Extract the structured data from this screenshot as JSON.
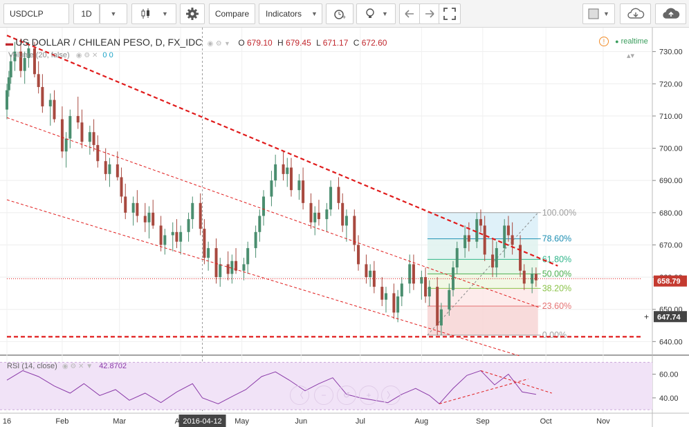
{
  "toolbar": {
    "symbol": "USDCLP",
    "interval": "1D",
    "compare_label": "Compare",
    "indicators_label": "Indicators"
  },
  "legend": {
    "title": "US DOLLAR / CHILEAN PESO, D, FX_IDC",
    "o_label": "O",
    "o": "679.10",
    "h_label": "H",
    "h": "679.45",
    "l_label": "L",
    "l": "671.17",
    "c_label": "C",
    "c": "672.60",
    "volume_label": "Volume (20, false)",
    "volume_values": [
      "0",
      "0"
    ],
    "realtime": "realtime"
  },
  "watermark": {
    "line1": "USDCLP, D",
    "line2": "US DOLLAR / CHILEAN PESO"
  },
  "rsi": {
    "label": "RSI (14, close)",
    "value": "42.8702"
  },
  "colors": {
    "up": "#4a8e6f",
    "down": "#a8493f",
    "trend": "#e01b1b",
    "rsi_line": "#8a3aa8",
    "rsi_band": "#f1e3f7",
    "price_badge": "#c43a30",
    "crosshair_badge": "#444444"
  },
  "chart_data": {
    "type": "candlestick",
    "symbol": "USDCLP",
    "timeframe": "D",
    "y_axis": {
      "ticks": [
        730.0,
        720.0,
        710.0,
        700.0,
        690.0,
        680.0,
        670.0,
        660.0,
        650.0,
        640.0
      ],
      "range": [
        636,
        737
      ]
    },
    "x_axis": {
      "ticks": [
        "16",
        "Feb",
        "Mar",
        "Apr",
        "May",
        "Jun",
        "Jul",
        "Aug",
        "Sep",
        "Oct",
        "Nov"
      ],
      "range": [
        "2016-01-04",
        "2016-11-21"
      ]
    },
    "crosshair_date": "2016-04-12",
    "last_price": 658.79,
    "crosshair_price": 647.74,
    "fibonacci": [
      {
        "level": "100.00%",
        "price": 680.0
      },
      {
        "level": "78.60%",
        "price": 671.9
      },
      {
        "level": "61.80%",
        "price": 665.5
      },
      {
        "level": "50.00%",
        "price": 661.0
      },
      {
        "level": "38.20%",
        "price": 656.5
      },
      {
        "level": "23.60%",
        "price": 651.0
      },
      {
        "level": "0.00%",
        "price": 642.0
      }
    ],
    "rsi_axis": {
      "ticks": [
        60.0,
        40.0
      ]
    },
    "candles": [
      [
        "2016-01-04",
        712,
        720,
        709,
        718
      ],
      [
        "2016-01-05",
        718,
        724,
        716,
        722
      ],
      [
        "2016-01-06",
        722,
        729,
        720,
        727
      ],
      [
        "2016-01-08",
        727,
        733,
        724,
        730
      ],
      [
        "2016-01-11",
        730,
        734,
        722,
        724
      ],
      [
        "2016-01-13",
        724,
        730,
        720,
        728
      ],
      [
        "2016-01-15",
        728,
        733,
        725,
        731
      ],
      [
        "2016-01-18",
        731,
        733,
        722,
        723
      ],
      [
        "2016-01-20",
        723,
        727,
        717,
        719
      ],
      [
        "2016-01-22",
        719,
        723,
        711,
        713
      ],
      [
        "2016-01-26",
        713,
        717,
        707,
        715
      ],
      [
        "2016-01-28",
        715,
        718,
        708,
        709
      ],
      [
        "2016-02-01",
        709,
        713,
        697,
        699
      ],
      [
        "2016-02-03",
        699,
        705,
        694,
        703
      ],
      [
        "2016-02-05",
        703,
        712,
        700,
        710
      ],
      [
        "2016-02-09",
        710,
        716,
        706,
        708
      ],
      [
        "2016-02-11",
        708,
        712,
        700,
        702
      ],
      [
        "2016-02-15",
        702,
        707,
        698,
        705
      ],
      [
        "2016-02-17",
        705,
        709,
        699,
        701
      ],
      [
        "2016-02-19",
        701,
        704,
        694,
        696
      ],
      [
        "2016-02-23",
        696,
        700,
        690,
        692
      ],
      [
        "2016-02-25",
        692,
        697,
        688,
        695
      ],
      [
        "2016-02-29",
        695,
        699,
        690,
        691
      ],
      [
        "2016-03-02",
        691,
        694,
        683,
        685
      ],
      [
        "2016-03-04",
        685,
        689,
        678,
        680
      ],
      [
        "2016-03-08",
        680,
        685,
        676,
        683
      ],
      [
        "2016-03-10",
        683,
        687,
        677,
        679
      ],
      [
        "2016-03-14",
        679,
        683,
        674,
        677
      ],
      [
        "2016-03-16",
        677,
        682,
        672,
        680
      ],
      [
        "2016-03-18",
        680,
        684,
        675,
        676
      ],
      [
        "2016-03-22",
        676,
        679,
        668,
        670
      ],
      [
        "2016-03-24",
        670,
        675,
        667,
        673
      ],
      [
        "2016-03-28",
        673,
        677,
        668,
        674
      ],
      [
        "2016-03-30",
        674,
        678,
        669,
        671
      ],
      [
        "2016-04-01",
        671,
        676,
        667,
        674
      ],
      [
        "2016-04-05",
        674,
        680,
        671,
        678
      ],
      [
        "2016-04-07",
        678,
        685,
        675,
        683
      ],
      [
        "2016-04-11",
        683,
        686,
        673,
        675
      ],
      [
        "2016-04-13",
        675,
        678,
        664,
        666
      ],
      [
        "2016-04-15",
        666,
        671,
        662,
        669
      ],
      [
        "2016-04-19",
        669,
        672,
        658,
        660
      ],
      [
        "2016-04-21",
        660,
        666,
        657,
        664
      ],
      [
        "2016-04-25",
        664,
        668,
        659,
        661
      ],
      [
        "2016-04-27",
        661,
        667,
        658,
        665
      ],
      [
        "2016-04-29",
        665,
        669,
        661,
        662
      ],
      [
        "2016-05-03",
        662,
        666,
        659,
        664
      ],
      [
        "2016-05-05",
        664,
        671,
        661,
        669
      ],
      [
        "2016-05-09",
        669,
        676,
        666,
        674
      ],
      [
        "2016-05-11",
        674,
        681,
        671,
        679
      ],
      [
        "2016-05-13",
        679,
        687,
        676,
        685
      ],
      [
        "2016-05-17",
        685,
        693,
        682,
        690
      ],
      [
        "2016-05-19",
        690,
        698,
        688,
        695
      ],
      [
        "2016-05-23",
        695,
        699,
        690,
        692
      ],
      [
        "2016-05-25",
        692,
        697,
        688,
        694
      ],
      [
        "2016-05-27",
        694,
        697,
        685,
        687
      ],
      [
        "2016-05-31",
        687,
        692,
        684,
        690
      ],
      [
        "2016-06-02",
        690,
        694,
        681,
        683
      ],
      [
        "2016-06-06",
        683,
        686,
        675,
        677
      ],
      [
        "2016-06-08",
        677,
        682,
        673,
        680
      ],
      [
        "2016-06-10",
        680,
        684,
        676,
        678
      ],
      [
        "2016-06-14",
        678,
        683,
        674,
        681
      ],
      [
        "2016-06-16",
        681,
        690,
        679,
        688
      ],
      [
        "2016-06-20",
        688,
        691,
        681,
        683
      ],
      [
        "2016-06-22",
        683,
        686,
        674,
        676
      ],
      [
        "2016-06-24",
        676,
        681,
        671,
        679
      ],
      [
        "2016-06-28",
        679,
        681,
        668,
        670
      ],
      [
        "2016-06-30",
        670,
        673,
        662,
        664
      ],
      [
        "2016-07-04",
        664,
        667,
        658,
        660
      ],
      [
        "2016-07-06",
        660,
        664,
        657,
        662
      ],
      [
        "2016-07-08",
        662,
        665,
        655,
        657
      ],
      [
        "2016-07-12",
        657,
        660,
        651,
        653
      ],
      [
        "2016-07-14",
        653,
        657,
        649,
        655
      ],
      [
        "2016-07-18",
        655,
        658,
        647,
        649
      ],
      [
        "2016-07-20",
        649,
        656,
        646,
        654
      ],
      [
        "2016-07-22",
        654,
        660,
        651,
        658
      ],
      [
        "2016-07-26",
        658,
        667,
        655,
        664
      ],
      [
        "2016-07-28",
        664,
        667,
        656,
        658
      ],
      [
        "2016-08-01",
        658,
        662,
        653,
        660
      ],
      [
        "2016-08-03",
        660,
        663,
        652,
        654
      ],
      [
        "2016-08-05",
        654,
        659,
        651,
        657
      ],
      [
        "2016-08-09",
        657,
        660,
        642,
        645
      ],
      [
        "2016-08-11",
        645,
        652,
        642,
        650
      ],
      [
        "2016-08-15",
        650,
        658,
        648,
        656
      ],
      [
        "2016-08-17",
        656,
        665,
        654,
        663
      ],
      [
        "2016-08-19",
        663,
        671,
        661,
        669
      ],
      [
        "2016-08-23",
        669,
        676,
        666,
        673
      ],
      [
        "2016-08-25",
        673,
        677,
        668,
        671
      ],
      [
        "2016-08-29",
        671,
        680,
        669,
        678
      ],
      [
        "2016-08-31",
        678,
        681,
        674,
        676
      ],
      [
        "2016-09-02",
        676,
        679,
        665,
        667
      ],
      [
        "2016-09-06",
        667,
        672,
        660,
        663
      ],
      [
        "2016-09-08",
        663,
        671,
        660,
        669
      ],
      [
        "2016-09-12",
        669,
        678,
        666,
        676
      ],
      [
        "2016-09-14",
        676,
        679,
        671,
        673
      ],
      [
        "2016-09-16",
        673,
        677,
        667,
        670
      ],
      [
        "2016-09-20",
        670,
        673,
        660,
        662
      ],
      [
        "2016-09-22",
        662,
        664,
        656,
        658
      ],
      [
        "2016-09-26",
        658,
        663,
        655,
        661
      ],
      [
        "2016-09-28",
        661,
        663,
        657,
        659
      ]
    ],
    "rsi": [
      [
        "2016-01-04",
        55
      ],
      [
        "2016-01-12",
        63
      ],
      [
        "2016-01-20",
        58
      ],
      [
        "2016-01-28",
        50
      ],
      [
        "2016-02-05",
        44
      ],
      [
        "2016-02-12",
        52
      ],
      [
        "2016-02-20",
        42
      ],
      [
        "2016-02-28",
        47
      ],
      [
        "2016-03-06",
        38
      ],
      [
        "2016-03-14",
        44
      ],
      [
        "2016-03-22",
        36
      ],
      [
        "2016-03-30",
        45
      ],
      [
        "2016-04-07",
        52
      ],
      [
        "2016-04-12",
        40
      ],
      [
        "2016-04-20",
        35
      ],
      [
        "2016-04-28",
        42
      ],
      [
        "2016-05-04",
        47
      ],
      [
        "2016-05-12",
        58
      ],
      [
        "2016-05-19",
        62
      ],
      [
        "2016-05-26",
        55
      ],
      [
        "2016-06-03",
        46
      ],
      [
        "2016-06-10",
        52
      ],
      [
        "2016-06-17",
        57
      ],
      [
        "2016-06-24",
        43
      ],
      [
        "2016-07-01",
        40
      ],
      [
        "2016-07-08",
        38
      ],
      [
        "2016-07-15",
        36
      ],
      [
        "2016-07-22",
        43
      ],
      [
        "2016-07-29",
        48
      ],
      [
        "2016-08-05",
        42
      ],
      [
        "2016-08-10",
        35
      ],
      [
        "2016-08-17",
        48
      ],
      [
        "2016-08-24",
        59
      ],
      [
        "2016-08-31",
        63
      ],
      [
        "2016-09-07",
        51
      ],
      [
        "2016-09-14",
        60
      ],
      [
        "2016-09-21",
        45
      ],
      [
        "2016-09-28",
        43
      ]
    ]
  }
}
